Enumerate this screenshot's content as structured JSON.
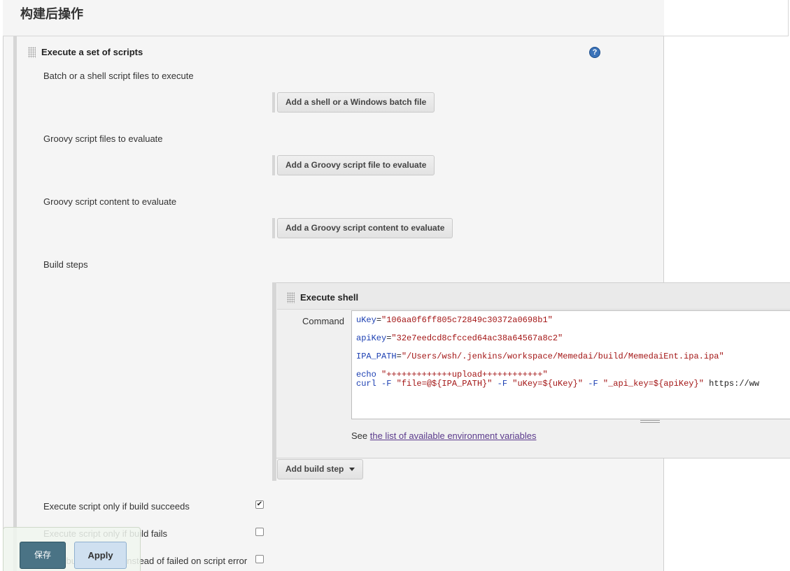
{
  "section": {
    "title": "构建后操作"
  },
  "execute_scripts": {
    "title": "Execute a set of scripts",
    "help_symbol": "?",
    "batch_label": "Batch or a shell script files to execute",
    "add_shell_btn": "Add a shell or a Windows batch file",
    "groovy_files_label": "Groovy script files to evaluate",
    "add_groovy_file_btn": "Add a Groovy script file to evaluate",
    "groovy_content_label": "Groovy script content to evaluate",
    "add_groovy_content_btn": "Add a Groovy script content to evaluate",
    "build_steps_label": "Build steps"
  },
  "execute_shell": {
    "title": "Execute shell",
    "command_label": "Command",
    "lines": [
      {
        "key": "uKey",
        "eq": "=",
        "val": "\"106aa0f6ff805c72849c30372a0698b1\""
      },
      {
        "key": "apiKey",
        "eq": "=",
        "val": "\"32e7eedcd8cfcced64ac38a64567a8c2\""
      },
      {
        "key": "IPA_PATH",
        "eq": "=",
        "val": "\"/Users/wsh/.jenkins/workspace/Memedai/build/MemedaiEnt.ipa.ipa\""
      },
      {
        "key": "echo",
        "eq": " ",
        "val": "\"+++++++++++++upload++++++++++++\""
      }
    ],
    "curl_line": {
      "cmd": "curl -F ",
      "a1": "\"file=@${IPA_PATH}\"",
      "m1": " -F ",
      "a2": "\"uKey=${uKey}\"",
      "m2": " -F ",
      "a3": "\"_api_key=${apiKey}\"",
      "tail": " https://ww"
    },
    "see_prefix": "See ",
    "see_link": "the list of available environment variables"
  },
  "add_build_step_btn": "Add build step",
  "options": [
    {
      "label": "Execute script only if build succeeds",
      "checked": true
    },
    {
      "label": "Execute script only if build fails",
      "checked": false
    },
    {
      "label": "Mark build unstable instead of failed on script error",
      "checked": false
    }
  ],
  "footer": {
    "save": "保存",
    "apply": "Apply"
  }
}
